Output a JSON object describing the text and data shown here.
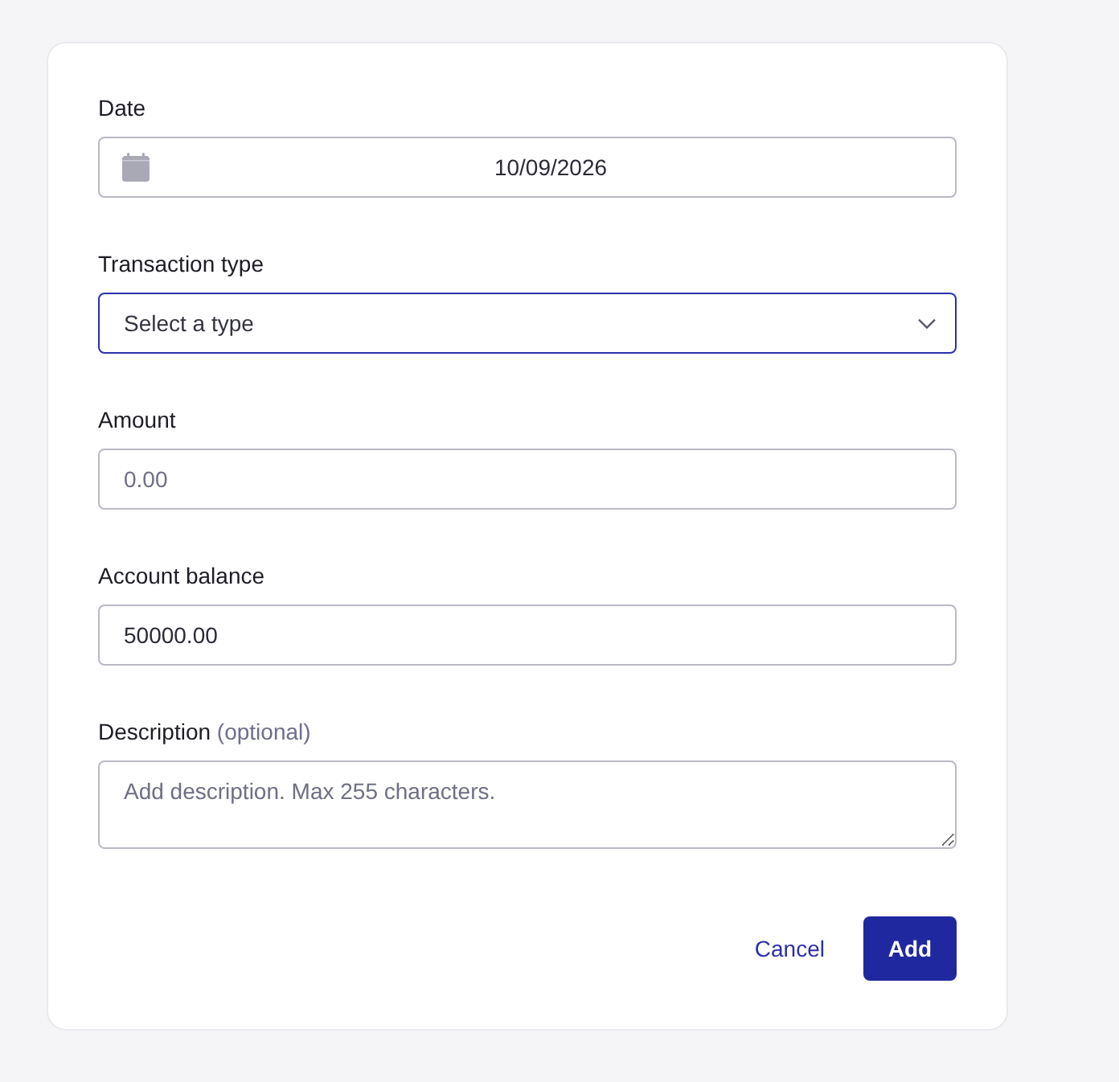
{
  "form": {
    "fields": [
      {
        "kind": "date",
        "label": "Date",
        "value": "10/09/2026",
        "focused": false
      },
      {
        "kind": "select",
        "label": "Transaction type",
        "placeholder": "Select a type",
        "focused": true
      },
      {
        "kind": "text",
        "label": "Amount",
        "placeholder": "0.00",
        "focused": false
      },
      {
        "kind": "text",
        "label": "Account balance",
        "value": "50000.00",
        "focused": false
      },
      {
        "kind": "textarea",
        "label": "Description",
        "hint": "(optional)",
        "placeholder": "Add description. Max 255 characters.",
        "focused": false
      }
    ]
  },
  "buttons": [
    {
      "kind": "link",
      "label": "Cancel"
    },
    {
      "kind": "primary",
      "label": "Add"
    }
  ]
}
